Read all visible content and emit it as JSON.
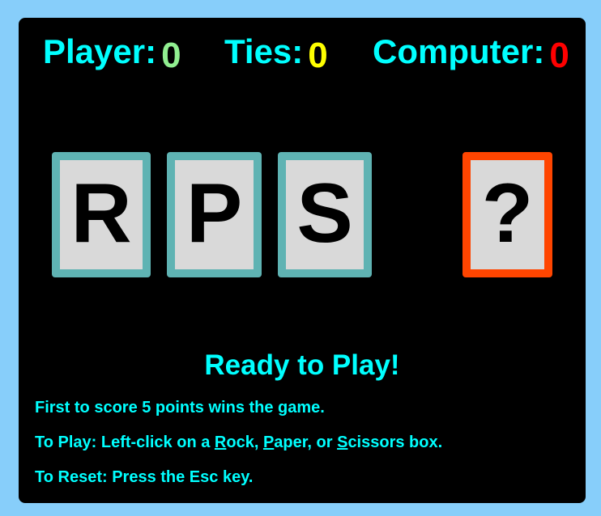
{
  "scoreboard": {
    "player_label": "Player:",
    "player_score": "0",
    "ties_label": "Ties:",
    "ties_score": "0",
    "computer_label": "Computer:",
    "computer_score": "0"
  },
  "choices": {
    "rock": "R",
    "paper": "P",
    "scissors": "S"
  },
  "computer_choice": "?",
  "status": "Ready to Play!",
  "instructions": {
    "line1": "First to score 5 points wins the game.",
    "line2_prefix": "To Play: Left-click on a ",
    "line2_rock_key": "R",
    "line2_rock_rest": "ock, ",
    "line2_paper_key": "P",
    "line2_paper_rest": "aper, or ",
    "line2_scissors_key": "S",
    "line2_scissors_rest": "cissors box.",
    "line3": "To Reset: Press the Esc key."
  },
  "colors": {
    "background": "#87cefa",
    "board": "#000000",
    "text_cyan": "#00ffff",
    "player_score": "#90ee90",
    "ties_score": "#ffff00",
    "computer_score": "#ff0000",
    "card_border": "#5fb3b3",
    "computer_card_border": "#ff4500",
    "card_face": "#d9d9d9"
  }
}
